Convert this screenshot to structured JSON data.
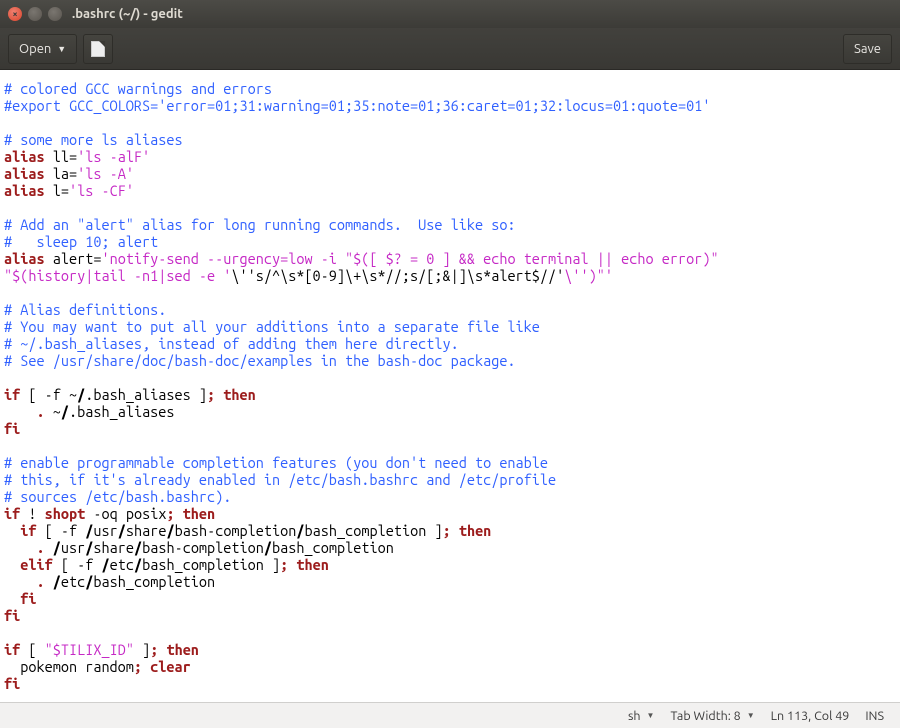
{
  "window": {
    "title": ".bashrc (~/) - gedit"
  },
  "toolbar": {
    "open": "Open",
    "save": "Save"
  },
  "status": {
    "lang": "sh",
    "tabwidth": "Tab Width: 8",
    "position": "Ln 113, Col 49",
    "mode": "INS"
  },
  "code": {
    "l1": "# colored GCC warnings and errors",
    "l2": "#export GCC_COLORS='error=01;31:warning=01;35:note=01;36:caret=01;32:locus=01:quote=01'",
    "l3": "# some more ls aliases",
    "l4a": "alias",
    "l4b": " ll=",
    "l4c": "'ls -alF'",
    "l5a": "alias",
    "l5b": " la=",
    "l5c": "'ls -A'",
    "l6a": "alias",
    "l6b": " l=",
    "l6c": "'ls -CF'",
    "l7": "# Add an \"alert\" alias for long running commands.  Use like so:",
    "l8": "#   sleep 10; alert",
    "l9a": "alias",
    "l9b": " alert=",
    "l9c": "'notify-send --urgency=low -i \"$([ $? = 0 ] && echo terminal || echo error)\" ",
    "l10a": "\"$(history|tail -n1|sed -e '",
    "l10b": "\\''s/^\\s*[0-9]\\+\\s*//;s/[;&|]\\s*alert$//'",
    "l10c": "\\'')\"'",
    "l11": "# Alias definitions.",
    "l12": "# You may want to put all your additions into a separate file like",
    "l13": "# ~/.bash_aliases, instead of adding them here directly.",
    "l14": "# See /usr/share/doc/bash-doc/examples in the bash-doc package.",
    "l15a": "if",
    "l15b": " [ -f ~",
    "l15s": "/",
    "l15c": ".bash_aliases ]",
    "l15d": ";",
    "l15e": " then",
    "l16a": "    ",
    "l16b": ".",
    "l16c": " ~",
    "l16s": "/",
    "l16d": ".bash_aliases",
    "l17": "fi",
    "l18": "# enable programmable completion features (you don't need to enable",
    "l19": "# this, if it's already enabled in /etc/bash.bashrc and /etc/profile",
    "l20": "# sources /etc/bash.bashrc).",
    "l21a": "if",
    "l21b": " ! ",
    "l21c": "shopt",
    "l21d": " -oq posix",
    "l21e": ";",
    "l21f": " then",
    "l22a": "  ",
    "l22b": "if",
    "l22c": " [ -f ",
    "l22s1": "/",
    "l22d": "usr",
    "l22s2": "/",
    "l22e": "share",
    "l22s3": "/",
    "l22f": "bash-completion",
    "l22s4": "/",
    "l22g": "bash_completion ]",
    "l22h": ";",
    "l22i": " then",
    "l23a": "    ",
    "l23b": ".",
    "l23c": " ",
    "l23s1": "/",
    "l23d": "usr",
    "l23s2": "/",
    "l23e": "share",
    "l23s3": "/",
    "l23f": "bash-completion",
    "l23s4": "/",
    "l23g": "bash_completion",
    "l24a": "  ",
    "l24b": "elif",
    "l24c": " [ -f ",
    "l24s1": "/",
    "l24d": "etc",
    "l24s2": "/",
    "l24e": "bash_completion ]",
    "l24f": ";",
    "l24g": " then",
    "l25a": "    ",
    "l25b": ".",
    "l25c": " ",
    "l25s1": "/",
    "l25d": "etc",
    "l25s2": "/",
    "l25e": "bash_completion",
    "l26a": "  ",
    "l26b": "fi",
    "l27": "fi",
    "l28a": "if",
    "l28b": " [ ",
    "l28c": "\"$TILIX_ID\"",
    "l28d": " ]",
    "l28e": ";",
    "l28f": " then",
    "l29a": "  pokemon random",
    "l29b": ";",
    "l29c": " clear",
    "l30": "fi"
  }
}
